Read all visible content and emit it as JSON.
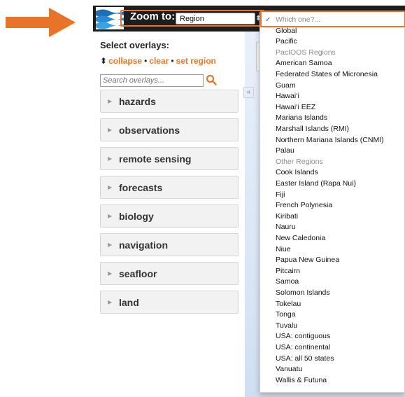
{
  "header": {
    "zoom_label": "Zoom to:",
    "zoom_selected": "Region"
  },
  "panel": {
    "title": "Select overlays:",
    "links": [
      "collapse",
      "clear",
      "set region"
    ],
    "search_placeholder": "Search overlays...",
    "categories": [
      "hazards",
      "observations",
      "remote sensing",
      "forecasts",
      "biology",
      "navigation",
      "seafloor",
      "land"
    ]
  },
  "dropdown": {
    "items": [
      {
        "label": "Which one?...",
        "kind": "placeholder"
      },
      {
        "label": "Global",
        "kind": "option"
      },
      {
        "label": "Pacific",
        "kind": "option"
      },
      {
        "label": "PacIOOS Regions",
        "kind": "header"
      },
      {
        "label": "American Samoa",
        "kind": "option"
      },
      {
        "label": "Federated States of Micronesia",
        "kind": "option"
      },
      {
        "label": "Guam",
        "kind": "option"
      },
      {
        "label": "Hawai‘i",
        "kind": "option"
      },
      {
        "label": "Hawai‘i EEZ",
        "kind": "option"
      },
      {
        "label": "Mariana Islands",
        "kind": "option"
      },
      {
        "label": "Marshall Islands (RMI)",
        "kind": "option"
      },
      {
        "label": "Northern Mariana Islands (CNMI)",
        "kind": "option"
      },
      {
        "label": "Palau",
        "kind": "option"
      },
      {
        "label": "Other Regions",
        "kind": "header"
      },
      {
        "label": "Cook Islands",
        "kind": "option"
      },
      {
        "label": "Easter Island (Rapa Nui)",
        "kind": "option"
      },
      {
        "label": "Fiji",
        "kind": "option"
      },
      {
        "label": "French Polynesia",
        "kind": "option"
      },
      {
        "label": "Kiribati",
        "kind": "option"
      },
      {
        "label": "Nauru",
        "kind": "option"
      },
      {
        "label": "New Caledonia",
        "kind": "option"
      },
      {
        "label": "Niue",
        "kind": "option"
      },
      {
        "label": "Papua New Guinea",
        "kind": "option"
      },
      {
        "label": "Pitcairn",
        "kind": "option"
      },
      {
        "label": "Samoa",
        "kind": "option"
      },
      {
        "label": "Solomon Islands",
        "kind": "option"
      },
      {
        "label": "Tokelau",
        "kind": "option"
      },
      {
        "label": "Tonga",
        "kind": "option"
      },
      {
        "label": "Tuvalu",
        "kind": "option"
      },
      {
        "label": "USA: contiguous",
        "kind": "option"
      },
      {
        "label": "USA: continental",
        "kind": "option"
      },
      {
        "label": "USA: all 50 states",
        "kind": "option"
      },
      {
        "label": "Vanuatu",
        "kind": "option"
      },
      {
        "label": "Wallis & Futuna",
        "kind": "option"
      }
    ]
  },
  "colors": {
    "accent": "#e87722",
    "highlight": "#e8742a",
    "topbar": "#1d1d1d"
  }
}
